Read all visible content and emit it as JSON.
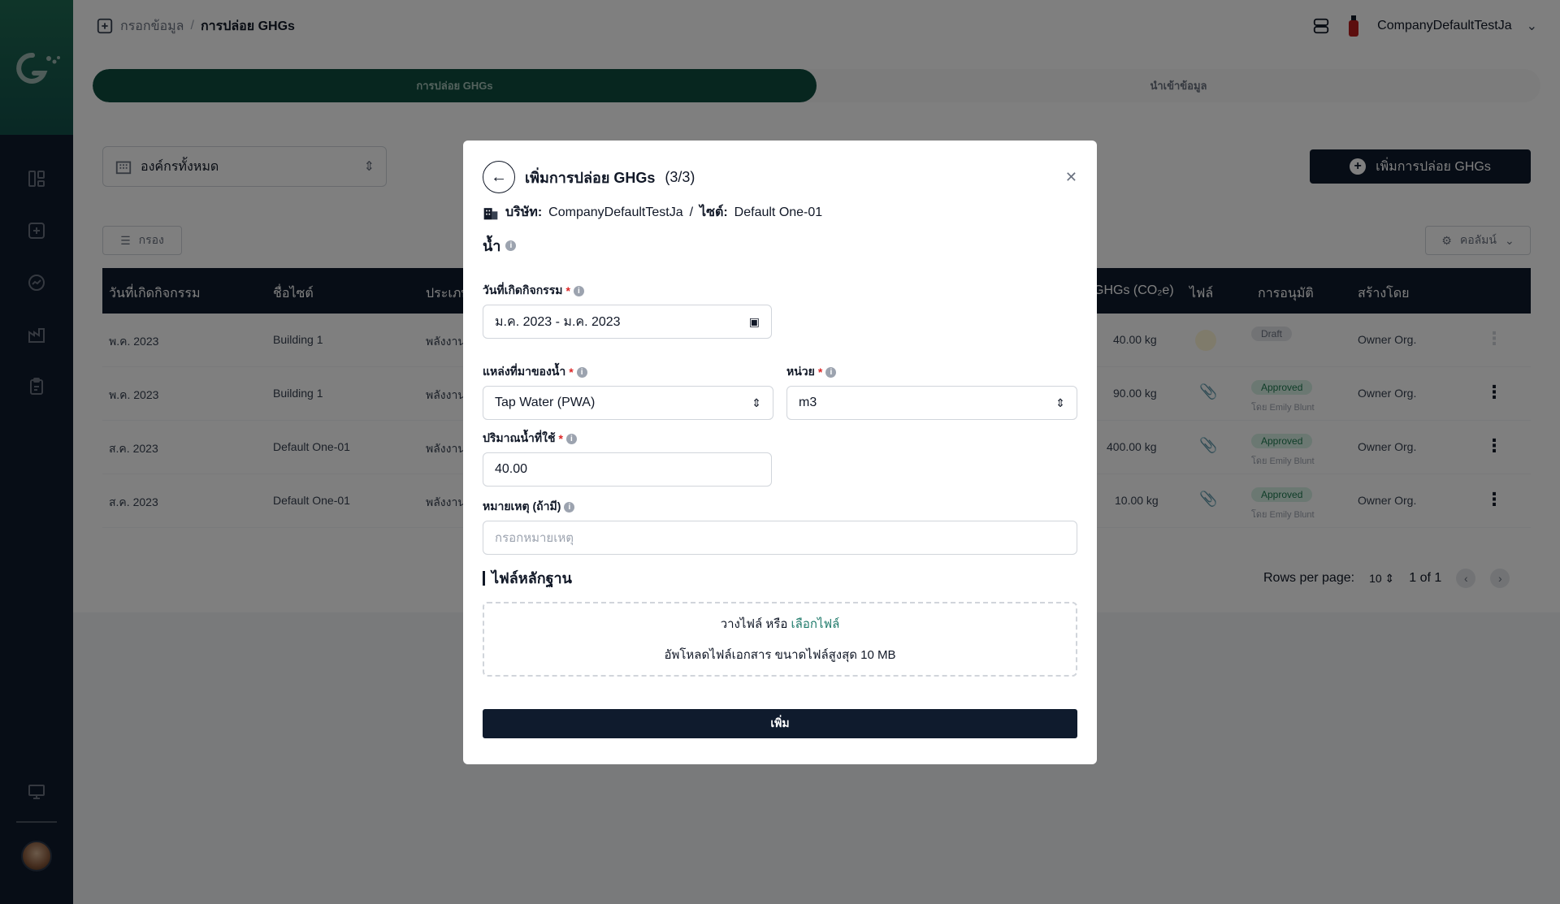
{
  "breadcrumb": {
    "parent": "กรอกข้อมูล",
    "separator": "/",
    "current": "การปล่อย GHGs"
  },
  "topbar": {
    "company": "CompanyDefaultTestJa"
  },
  "tabs": [
    {
      "label": "การปล่อย GHGs",
      "active": true
    },
    {
      "label": "นำเข้าข้อมูล",
      "active": false
    }
  ],
  "toolbar": {
    "org_select": "องค์กรทั้งหมด",
    "add_button": "เพิ่มการปล่อย GHGs",
    "filter_button": "กรอง",
    "columns_button": "คอลัมน์"
  },
  "table": {
    "headers": [
      "วันที่เกิดกิจกรรม",
      "ชื่อไซต์",
      "ประเภท",
      "GHGs (CO₂e)",
      "ไฟล์",
      "การอนุมัติ",
      "สร้างโดย"
    ],
    "rows": [
      {
        "date": "พ.ค. 2023",
        "site": "Building 1",
        "type": "พลังงาน",
        "ghg": "40.00 kg",
        "status": "Draft",
        "approved_by": "",
        "created_by": "Owner Org."
      },
      {
        "date": "พ.ค. 2023",
        "site": "Building 1",
        "type": "พลังงาน",
        "ghg": "90.00 kg",
        "status": "Approved",
        "approved_by": "โดย Emily Blunt",
        "created_by": "Owner Org."
      },
      {
        "date": "ส.ค. 2023",
        "site": "Default One-01",
        "type": "พลังงาน",
        "ghg": "400.00 kg",
        "status": "Approved",
        "approved_by": "โดย Emily Blunt",
        "created_by": "Owner Org."
      },
      {
        "date": "ส.ค. 2023",
        "site": "Default One-01",
        "type": "พลังงาน",
        "ghg": "10.00 kg",
        "status": "Approved",
        "approved_by": "โดย Emily Blunt",
        "created_by": "Owner Org."
      }
    ],
    "pagination": {
      "rows_per_page_label": "Rows per page:",
      "rows_per_page": "10",
      "page_info": "1 of 1"
    }
  },
  "modal": {
    "title": "เพิ่มการปล่อย GHGs",
    "step": "(3/3)",
    "company_label": "บริษัท:",
    "company_value": "CompanyDefaultTestJa",
    "separator": "/",
    "site_label": "ไซต์:",
    "site_value": "Default One-01",
    "section": "น้ำ",
    "date_label": "วันที่เกิดกิจกรรม",
    "date_value": "ม.ค. 2023 - ม.ค. 2023",
    "source_label": "แหล่งที่มาของน้ำ",
    "source_value": "Tap Water (PWA)",
    "unit_label": "หน่วย",
    "unit_value": "m3",
    "amount_label": "ปริมาณน้ำที่ใช้",
    "amount_value": "40.00",
    "note_label": "หมายเหตุ (ถ้ามี)",
    "note_placeholder": "กรอกหมายเหตุ",
    "evidence_title": "ไฟล์หลักฐาน",
    "drop_text": "วางไฟล์ หรือ",
    "drop_link": "เลือกไฟล์",
    "drop_hint": "อัพโหลดไฟล์เอกสาร ขนาดไฟล์สูงสุด 10 MB",
    "submit": "เพิ่ม"
  },
  "colors": {
    "brand": "#0e4d3f",
    "dark": "#0f1b2d",
    "required": "#dc2626",
    "link": "#1f7a6a"
  }
}
